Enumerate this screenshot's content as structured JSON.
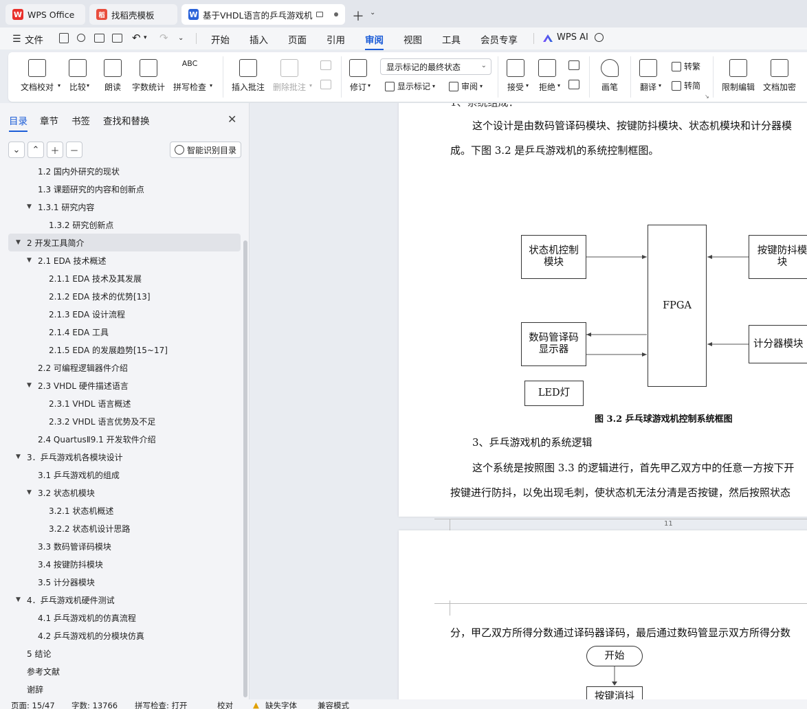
{
  "tabs": [
    {
      "label": "WPS Office",
      "logo": "W"
    },
    {
      "label": "找稻壳模板",
      "logo": "稻"
    },
    {
      "label": "基于VHDL语言的乒乓游戏机甲",
      "logo": "W"
    }
  ],
  "menu": [
    "文件",
    "开始",
    "插入",
    "页面",
    "引用",
    "审阅",
    "视图",
    "工具",
    "会员专享",
    "WPS AI"
  ],
  "menu_active": "审阅",
  "ribbon": {
    "doc_check": "文档校对",
    "compare": "比较",
    "read_aloud": "朗读",
    "word_count": "字数统计",
    "spell_check": "拼写检查",
    "insert_comment": "插入批注",
    "delete_comment": "删除批注",
    "revise": "修订",
    "markup_select": "显示标记的最终状态",
    "show_markup": "显示标记",
    "review": "审阅",
    "accept": "接受",
    "reject": "拒绝",
    "pen": "画笔",
    "translate": "翻译",
    "to_traditional": "转繁",
    "to_simplified": "转简",
    "restrict_edit": "限制编辑",
    "doc_encrypt": "文档加密"
  },
  "nav": {
    "tabs": [
      "目录",
      "章节",
      "书签",
      "查找和替换"
    ],
    "smart_btn": "智能识别目录",
    "toc": [
      {
        "label": "1.2 国内外研究的现状",
        "level": 2,
        "arrow": ""
      },
      {
        "label": "1.3 课题研究的内容和创新点",
        "level": 2,
        "arrow": ""
      },
      {
        "label": "1.3.1  研究内容",
        "level": 2,
        "arrow": "▼"
      },
      {
        "label": "1.3.2  研究创新点",
        "level": 3,
        "arrow": ""
      },
      {
        "label": "2  开发工具简介",
        "level": 1,
        "arrow": "▼"
      },
      {
        "label": "2.1 EDA 技术概述",
        "level": 2,
        "arrow": "▼"
      },
      {
        "label": "2.1.1 EDA 技术及其发展",
        "level": 3,
        "arrow": ""
      },
      {
        "label": "2.1.2 EDA 技术的优势[13]",
        "level": 3,
        "arrow": ""
      },
      {
        "label": "2.1.3 EDA 设计流程",
        "level": 3,
        "arrow": ""
      },
      {
        "label": "2.1.4 EDA 工具",
        "level": 3,
        "arrow": ""
      },
      {
        "label": "2.1.5 EDA 的发展趋势[15~17]",
        "level": 3,
        "arrow": ""
      },
      {
        "label": "2.2 可编程逻辑器件介绍",
        "level": 2,
        "arrow": ""
      },
      {
        "label": "2.3 VHDL 硬件描述语言",
        "level": 2,
        "arrow": "▼"
      },
      {
        "label": "2.3.1 VHDL 语言概述",
        "level": 3,
        "arrow": ""
      },
      {
        "label": "2.3.2 VHDL 语言优势及不足",
        "level": 3,
        "arrow": ""
      },
      {
        "label": "2.4 QuartusⅡ9.1 开发软件介绍",
        "level": 2,
        "arrow": ""
      },
      {
        "label": "3．乒乓游戏机各模块设计",
        "level": 1,
        "arrow": "▼"
      },
      {
        "label": "3.1 乒乓游戏机的组成",
        "level": 2,
        "arrow": ""
      },
      {
        "label": "3.2 状态机模块",
        "level": 2,
        "arrow": "▼"
      },
      {
        "label": "3.2.1  状态机概述",
        "level": 3,
        "arrow": ""
      },
      {
        "label": "3.2.2  状态机设计思路",
        "level": 3,
        "arrow": ""
      },
      {
        "label": "3.3 数码管译码模块",
        "level": 2,
        "arrow": ""
      },
      {
        "label": "3.4 按键防抖模块",
        "level": 2,
        "arrow": ""
      },
      {
        "label": "3.5 计分器模块",
        "level": 2,
        "arrow": ""
      },
      {
        "label": "4．乒乓游戏机硬件测试",
        "level": 1,
        "arrow": "▼"
      },
      {
        "label": "4.1 乒乓游戏机的仿真流程",
        "level": 2,
        "arrow": ""
      },
      {
        "label": "4.2 乒乓游戏机的分模块仿真",
        "level": 2,
        "arrow": ""
      },
      {
        "label": "5  结论",
        "level": 1,
        "arrow": ""
      },
      {
        "label": "参考文献",
        "level": 1,
        "arrow": ""
      },
      {
        "label": "谢辞",
        "level": 1,
        "arrow": ""
      }
    ],
    "selected_index": 4
  },
  "doc": {
    "para_top_partial": "1、系统组成：",
    "para1_line1": "这个设计是由数码管译码模块、按键防抖模块、状态机模块和计分器模",
    "para1_line2": "成。下图 3.2 是乒乓游戏机的系统控制框图。",
    "diagram": {
      "state_machine": "状态机控制模块",
      "fpga": "FPGA",
      "debounce": "按键防抖模块",
      "decoder": "数码管译码显示器",
      "counter": "计分器模块",
      "led": "LED灯"
    },
    "caption": "图 3.2  乒乓球游戏机控制系统框图",
    "heading3": "3、乒乓游戏机的系统逻辑",
    "para2_line1": "这个系统是按照图 3.3 的逻辑进行，首先甲乙双方中的任意一方按下开",
    "para2_line2": "按键进行防抖，以免出现毛刺，使状态机无法分清是否按键，然后按照状态",
    "page_number": "11",
    "page2_line": "分，甲乙双方所得分数通过译码器译码，最后通过数码管显示双方所得分数",
    "flow_start": "开始",
    "flow_next": "按键消抖"
  },
  "status": {
    "page": "页面: 15/47",
    "words": "字数: 13766",
    "spell": "拼写检查: 打开",
    "proof": "校对",
    "missing_font": "缺失字体",
    "compat": "兼容模式"
  }
}
